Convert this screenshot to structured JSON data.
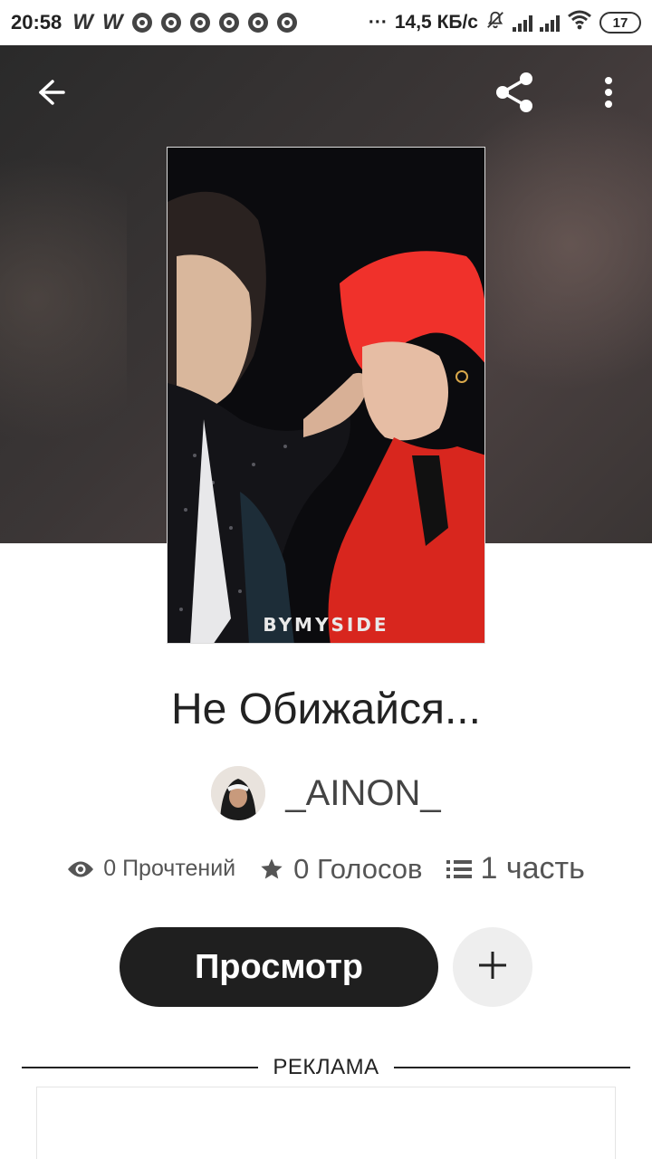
{
  "status_bar": {
    "time": "20:58",
    "network_speed": "14,5 КБ/с",
    "battery": "17",
    "ellipsis": "···"
  },
  "header": {
    "back_icon": "arrow-left-icon",
    "share_icon": "share-icon",
    "more_icon": "more-vert-icon"
  },
  "cover": {
    "caption": "BYMYSIDE"
  },
  "story": {
    "title": "Не Обижайся...",
    "author": "_AINON_"
  },
  "stats": {
    "reads": "0 Прочтений",
    "votes": "0 Голосов",
    "parts": "1 часть"
  },
  "actions": {
    "view_label": "Просмотр",
    "add_icon": "plus-icon"
  },
  "ad": {
    "label": "РЕКЛАМА"
  },
  "colors": {
    "button_dark": "#1f1f1f",
    "add_button_bg": "#eeeeee",
    "hero_bg": "#353030"
  }
}
